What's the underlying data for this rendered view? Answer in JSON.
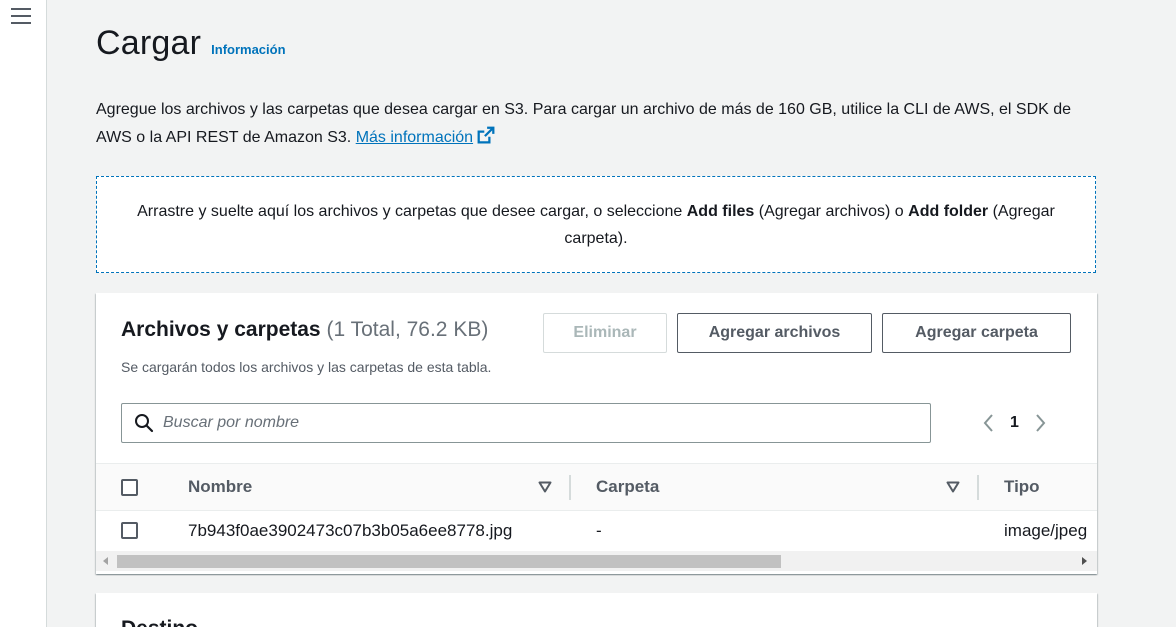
{
  "page": {
    "title": "Cargar",
    "info_link": "Información"
  },
  "description": {
    "text": "Agregue los archivos y las carpetas que desea cargar en S3. Para cargar un archivo de más de 160 GB, utilice la CLI de AWS, el SDK de AWS o la API REST de Amazon S3.",
    "link": "Más información"
  },
  "dropzone": {
    "text_before": "Arrastre y suelte aquí los archivos y carpetas que desee cargar, o seleccione ",
    "add_files": "Add files",
    "add_files_es": " (Agregar archivos) o ",
    "add_folder": "Add folder",
    "add_folder_es": " (Agregar carpeta)."
  },
  "files_panel": {
    "title": "Archivos y carpetas",
    "count": "(1 Total, 76.2 KB)",
    "subtitle": "Se cargarán todos los archivos y las carpetas de esta tabla.",
    "buttons": {
      "delete": "Eliminar",
      "add_files": "Agregar archivos",
      "add_folder": "Agregar carpeta"
    },
    "search_placeholder": "Buscar por nombre",
    "pagination": {
      "current_page": "1"
    },
    "columns": [
      "Nombre",
      "Carpeta",
      "Tipo"
    ],
    "rows": [
      {
        "name": "7b943f0ae3902473c07b3b05a6ee8778.jpg",
        "folder": "-",
        "type": "image/jpeg"
      }
    ]
  },
  "destination_panel": {
    "title": "Destino"
  },
  "colors": {
    "link": "#0073bb",
    "text": "#16191f",
    "muted": "#545b64",
    "background": "#f2f3f3"
  }
}
